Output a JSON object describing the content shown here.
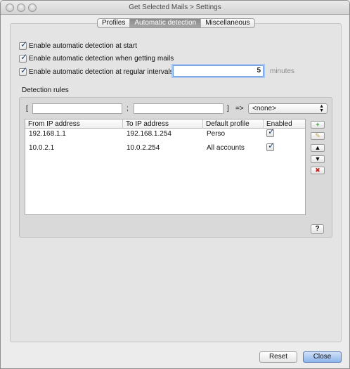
{
  "window": {
    "title": "Get Selected Mails > Settings"
  },
  "tabs": [
    {
      "label": "Profiles",
      "active": false
    },
    {
      "label": "Automatic detection",
      "active": true
    },
    {
      "label": "Miscellaneous",
      "active": false
    }
  ],
  "options": {
    "at_start": {
      "label": "Enable automatic detection at start",
      "checked": true
    },
    "getting_mails": {
      "label": "Enable automatic detection when getting mails",
      "checked": true
    },
    "intervals": {
      "label": "Enable automatic detection at regular intervals",
      "checked": true,
      "value": "5",
      "unit": "minutes"
    }
  },
  "rules": {
    "group_label": "Detection rules",
    "editor": {
      "open_bracket": "[",
      "separator": ";",
      "close_bracket": "]",
      "arrow": "=>",
      "profile_select": "<none>",
      "from_value": "",
      "to_value": ""
    },
    "columns": [
      "From IP address",
      "To IP address",
      "Default profile",
      "Enabled"
    ],
    "rows": [
      {
        "from": "192.168.1.1",
        "to": "192.168.1.254",
        "profile": "Perso",
        "enabled": true
      },
      {
        "from": "10.0.2.1",
        "to": "10.0.2.254",
        "profile": "All accounts",
        "enabled": true
      }
    ],
    "help_label": "?"
  },
  "buttons": {
    "reset": "Reset",
    "close": "Close"
  },
  "colors": {
    "accent": "#1d3f78",
    "add_green": "#2e9a2e",
    "remove_red": "#c8201b"
  }
}
